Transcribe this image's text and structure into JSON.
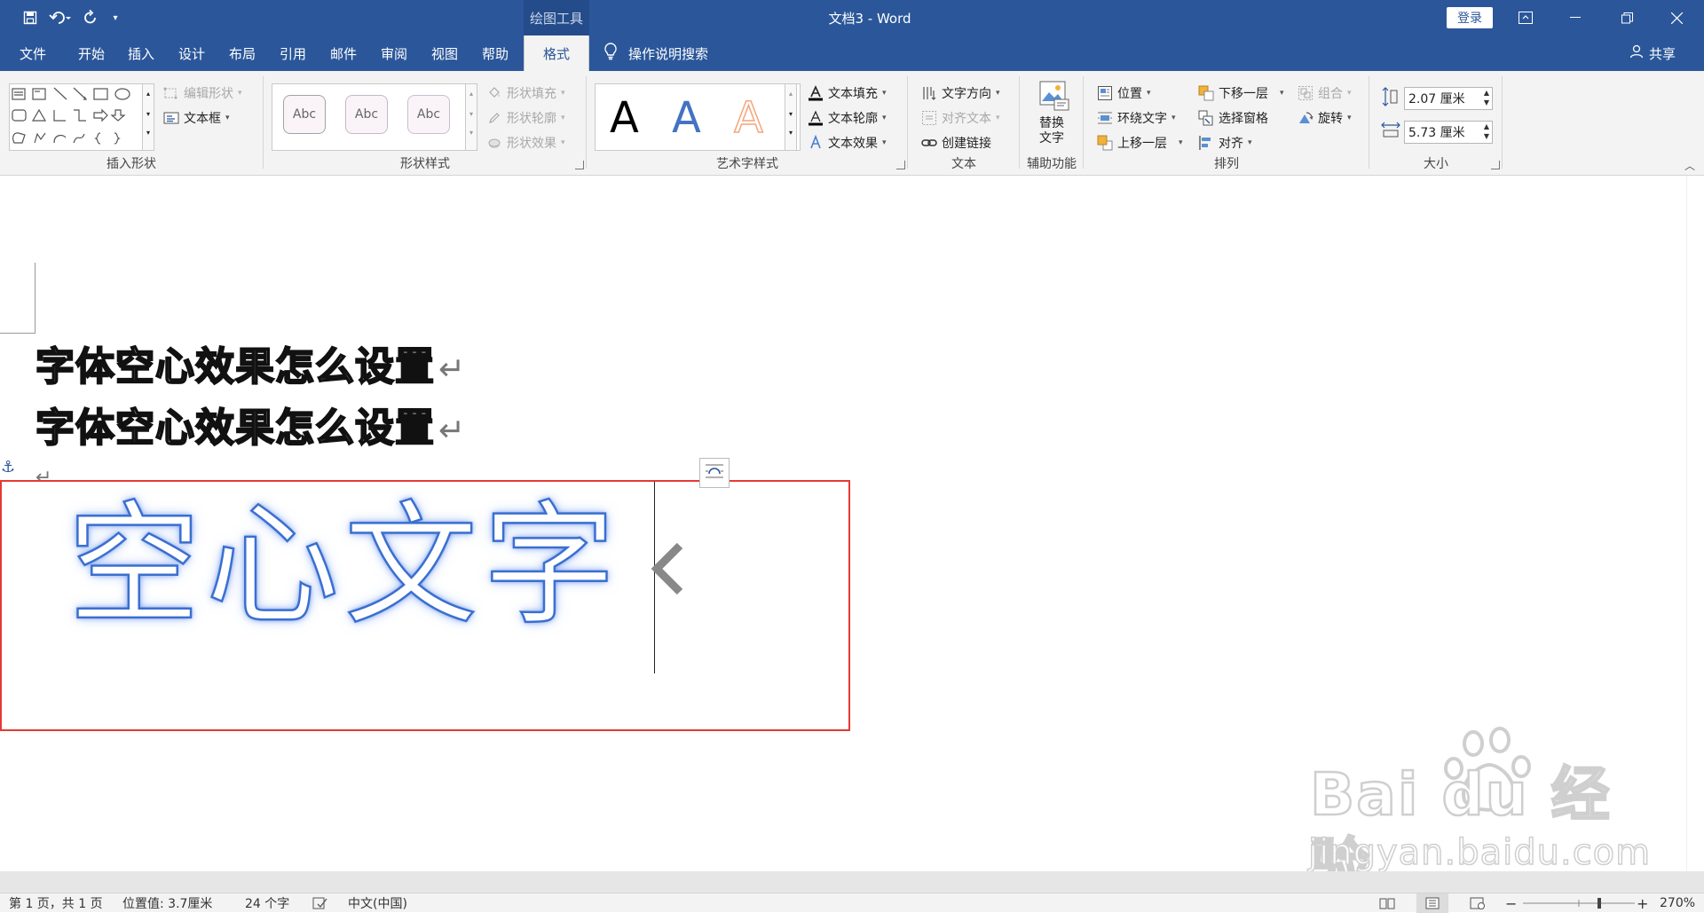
{
  "titlebar": {
    "context_tool": "绘图工具",
    "document_title": "文档3  -  Word",
    "login": "登录"
  },
  "tabs": [
    {
      "label": "文件"
    },
    {
      "label": "开始"
    },
    {
      "label": "插入"
    },
    {
      "label": "设计"
    },
    {
      "label": "布局"
    },
    {
      "label": "引用"
    },
    {
      "label": "邮件"
    },
    {
      "label": "审阅"
    },
    {
      "label": "视图"
    },
    {
      "label": "帮助"
    },
    {
      "label": "格式",
      "active": true
    }
  ],
  "tell_me": "操作说明搜索",
  "share": "共享",
  "ribbon": {
    "insert_shapes": {
      "label": "插入形状",
      "edit_shape": "编辑形状",
      "text_box": "文本框"
    },
    "shape_styles": {
      "label": "形状样式",
      "gallery": [
        "Abc",
        "Abc",
        "Abc"
      ],
      "fill": "形状填充",
      "outline": "形状轮廓",
      "effects": "形状效果"
    },
    "wordart_styles": {
      "label": "艺术字样式",
      "gallery": [
        "A",
        "A",
        "A"
      ],
      "text_fill": "文本填充",
      "text_outline": "文本轮廓",
      "text_effects": "文本效果"
    },
    "text": {
      "label": "文本",
      "direction": "文字方向",
      "align": "对齐文本",
      "link": "创建链接"
    },
    "accessibility": {
      "label": "辅助功能",
      "alt_text_line1": "替换",
      "alt_text_line2": "文字"
    },
    "arrange": {
      "label": "排列",
      "position": "位置",
      "wrap": "环绕文字",
      "bring_forward": "上移一层",
      "send_backward": "下移一层",
      "selection_pane": "选择窗格",
      "align": "对齐",
      "group": "组合",
      "rotate": "旋转"
    },
    "size": {
      "label": "大小",
      "height": "2.07 厘米",
      "width": "5.73 厘米"
    }
  },
  "document": {
    "line1": "字体空心效果怎么设置",
    "line2": "字体空心效果怎么设置",
    "para_mark": "↵",
    "wordart_text": "空心文字"
  },
  "watermark": {
    "brand": "Bai du 经验",
    "url": "jingyan.baidu.com"
  },
  "statusbar": {
    "page": "第 1 页，共 1 页",
    "position": "位置值: 3.7厘米",
    "words": "24 个字",
    "language": "中文(中国)",
    "zoom": "270%"
  },
  "colors": {
    "ribbon_blue": "#2b579a",
    "selection_red": "#e53935",
    "wordart_outline": "#3a6fd0"
  }
}
